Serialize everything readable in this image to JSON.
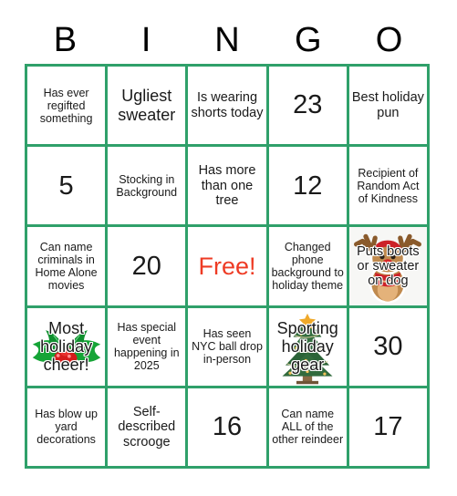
{
  "card": {
    "title_letters": [
      "B",
      "I",
      "N",
      "G",
      "O"
    ],
    "border_color": "#2fa06a",
    "free_color": "#ee3b24",
    "rows": [
      [
        {
          "text": "Has ever regifted something",
          "size": "small",
          "art": "none"
        },
        {
          "text": "Ugliest sweater",
          "size": "large",
          "art": "none"
        },
        {
          "text": "Is wearing shorts today",
          "size": "medium",
          "art": "none"
        },
        {
          "text": "23",
          "size": "number",
          "art": "none"
        },
        {
          "text": "Best holiday pun",
          "size": "medium",
          "art": "none"
        }
      ],
      [
        {
          "text": "5",
          "size": "number",
          "art": "none"
        },
        {
          "text": "Stocking in Background",
          "size": "small",
          "art": "none"
        },
        {
          "text": "Has more than one tree",
          "size": "medium",
          "art": "none"
        },
        {
          "text": "12",
          "size": "number",
          "art": "none"
        },
        {
          "text": "Recipient of Random Act of Kindness",
          "size": "small",
          "art": "none"
        }
      ],
      [
        {
          "text": "Can name criminals in Home Alone movies",
          "size": "small",
          "art": "none"
        },
        {
          "text": "20",
          "size": "number",
          "art": "none"
        },
        {
          "text": "Free!",
          "size": "free",
          "art": "none"
        },
        {
          "text": "Changed phone background to holiday theme",
          "size": "small",
          "art": "none"
        },
        {
          "text": "Puts boots or sweater on dog",
          "size": "medium",
          "art": "reindeer"
        }
      ],
      [
        {
          "text": "Most holiday cheer!",
          "size": "large",
          "art": "holly"
        },
        {
          "text": "Has special event happening in 2025",
          "size": "small",
          "art": "none"
        },
        {
          "text": "Has seen NYC ball drop in-person",
          "size": "small",
          "art": "none"
        },
        {
          "text": "Sporting holiday gear",
          "size": "large",
          "art": "tree"
        },
        {
          "text": "30",
          "size": "number",
          "art": "none"
        }
      ],
      [
        {
          "text": "Has blow up yard decorations",
          "size": "small",
          "art": "none"
        },
        {
          "text": "Self-described scrooge",
          "size": "medium",
          "art": "none"
        },
        {
          "text": "16",
          "size": "number",
          "art": "none"
        },
        {
          "text": "Can name ALL of the other reindeer",
          "size": "small",
          "art": "none"
        },
        {
          "text": "17",
          "size": "number",
          "art": "none"
        }
      ]
    ]
  }
}
